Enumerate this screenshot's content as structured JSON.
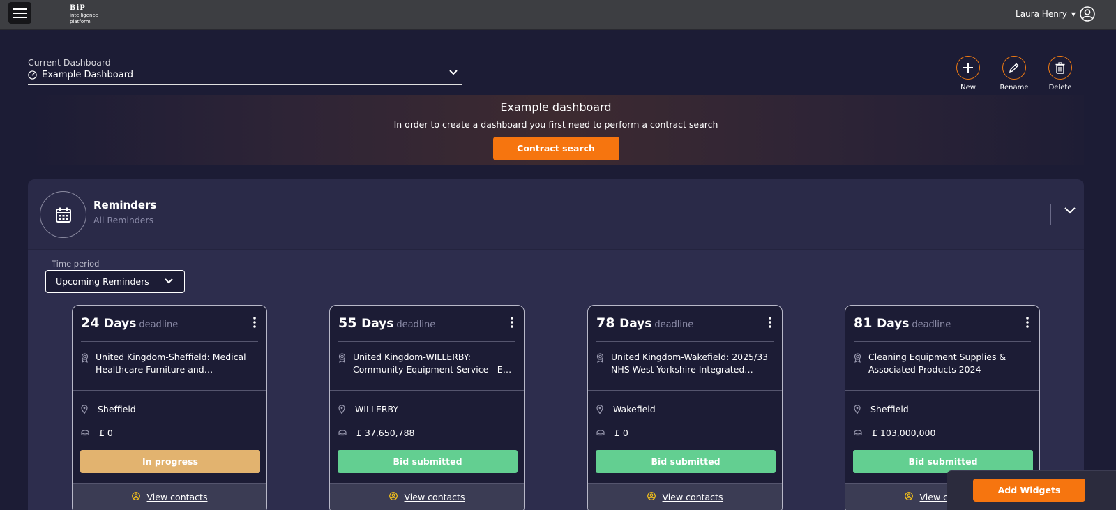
{
  "header": {
    "logo_mark": "BiP",
    "logo_line1": "intelligence",
    "logo_line2": "platform",
    "user_name": "Laura Henry"
  },
  "dashboard": {
    "label": "Current Dashboard",
    "selected": "Example Dashboard",
    "actions": {
      "new_label": "New",
      "rename_label": "Rename",
      "delete_label": "Delete"
    }
  },
  "banner": {
    "title": "Example dashboard",
    "text": "In order to create a dashboard you first need to perform a contract search",
    "button_label": "Contract search"
  },
  "reminders": {
    "title": "Reminders",
    "subtitle": "All Reminders",
    "time_period_label": "Time period",
    "time_period_value": "Upcoming Reminders",
    "cards": [
      {
        "days": "24",
        "days_unit": "Days",
        "deadline_label": "deadline",
        "title": "United Kingdom-Sheffield: Medical Healthcare Furniture and Equipment...",
        "location": "Sheffield",
        "value": "£ 0",
        "status": "In progress",
        "status_color": "#e2b36f",
        "contacts_label": "View contacts"
      },
      {
        "days": "55",
        "days_unit": "Days",
        "deadline_label": "deadline",
        "title": "United Kingdom-WILLERBY: Community Equipment Service - East Riding of...",
        "location": "WILLERBY",
        "value": "£ 37,650,788",
        "status": "Bid submitted",
        "status_color": "#63cf91",
        "contacts_label": "View contacts"
      },
      {
        "days": "78",
        "days_unit": "Days",
        "deadline_label": "deadline",
        "title": "United Kingdom-Wakefield: 2025/33 NHS West Yorkshire Integrated Care...",
        "location": "Wakefield",
        "value": "£ 0",
        "status": "Bid submitted",
        "status_color": "#63cf91",
        "contacts_label": "View contacts"
      },
      {
        "days": "81",
        "days_unit": "Days",
        "deadline_label": "deadline",
        "title": "Cleaning Equipment Supplies & Associated Products 2024",
        "location": "Sheffield",
        "value": "£ 103,000,000",
        "status": "Bid submitted",
        "status_color": "#63cf91",
        "contacts_label": "View contacts"
      }
    ]
  },
  "footer": {
    "add_widgets_label": "Add Widgets"
  },
  "colors": {
    "accent": "#f6750f",
    "background": "#1c1c35",
    "panel": "#2d2d4d"
  }
}
